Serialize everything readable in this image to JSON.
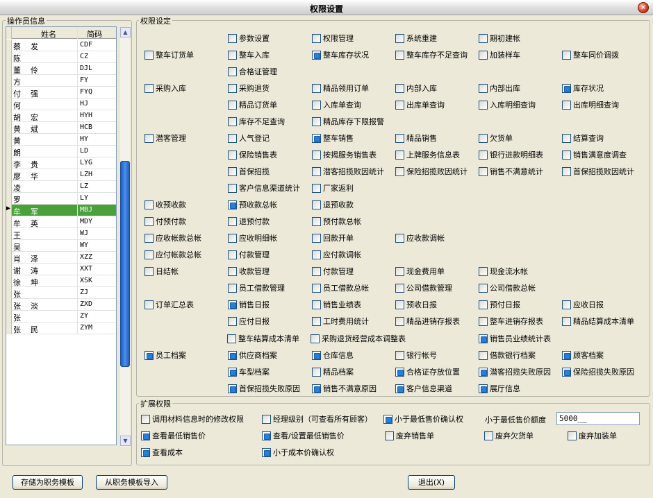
{
  "window": {
    "title": "权限设置",
    "close_glyph": "×"
  },
  "operator_panel": {
    "legend": "操作员信息",
    "columns": [
      "姓名",
      "简码"
    ],
    "rows": [
      {
        "s": "蔡",
        "g": "发",
        "code": "CDF"
      },
      {
        "s": "陈",
        "g": "",
        "code": "CZ"
      },
      {
        "s": "董",
        "g": "伶",
        "code": "DJL"
      },
      {
        "s": "方",
        "g": "",
        "code": "FY"
      },
      {
        "s": "付",
        "g": "强",
        "code": "FYQ"
      },
      {
        "s": "何",
        "g": "",
        "code": "HJ"
      },
      {
        "s": "胡",
        "g": "宏",
        "code": "HYH"
      },
      {
        "s": "黄",
        "g": "斌",
        "code": "HCB"
      },
      {
        "s": "黄",
        "g": "",
        "code": "HY"
      },
      {
        "s": "朗",
        "g": "",
        "code": "LD"
      },
      {
        "s": "李",
        "g": "贵",
        "code": "LYG"
      },
      {
        "s": "廖",
        "g": "华",
        "code": "LZH"
      },
      {
        "s": "凌",
        "g": "",
        "code": "LZ"
      },
      {
        "s": "罗",
        "g": "",
        "code": "LY"
      },
      {
        "s": "牟",
        "g": "军",
        "code": "MBJ"
      },
      {
        "s": "牟",
        "g": "英",
        "code": "MDY"
      },
      {
        "s": "王",
        "g": "",
        "code": "WJ"
      },
      {
        "s": "吴",
        "g": "",
        "code": "WY"
      },
      {
        "s": "肖",
        "g": "泽",
        "code": "XZZ"
      },
      {
        "s": "谢",
        "g": "涛",
        "code": "XXT"
      },
      {
        "s": "徐",
        "g": "坤",
        "code": "XSK"
      },
      {
        "s": "张",
        "g": "",
        "code": "ZJ"
      },
      {
        "s": "张",
        "g": "淡",
        "code": "ZXD"
      },
      {
        "s": "张",
        "g": "",
        "code": "ZY"
      },
      {
        "s": "张",
        "g": "民",
        "code": "ZYM"
      }
    ],
    "selected_code": "MBJ",
    "row_pointer": "▶"
  },
  "permissions_panel": {
    "legend": "权限设定",
    "lines": [
      [
        [
          1,
          "参数设置",
          false
        ],
        [
          2,
          "权限管理",
          false
        ],
        [
          3,
          "系统重建",
          false
        ],
        [
          4,
          "期初建帐",
          false
        ]
      ],
      [
        [
          0,
          "整车订货单",
          false
        ],
        [
          1,
          "整车入库",
          false
        ],
        [
          2,
          "整车库存状况",
          true
        ],
        [
          3,
          "整车库存不足查询",
          false
        ],
        [
          4,
          "加装样车",
          false
        ],
        [
          5,
          "整车同价调拨",
          false
        ]
      ],
      [
        [
          1,
          "合格证管理",
          false
        ]
      ],
      [
        [
          0,
          "采购入库",
          false
        ],
        [
          1,
          "采购退货",
          false
        ],
        [
          2,
          "精品领用订单",
          false
        ],
        [
          3,
          "内部入库",
          false
        ],
        [
          4,
          "内部出库",
          false
        ],
        [
          5,
          "库存状况",
          true
        ]
      ],
      [
        [
          1,
          "精品订货单",
          false
        ],
        [
          2,
          "入库单查询",
          false
        ],
        [
          3,
          "出库单查询",
          false
        ],
        [
          4,
          "入库明细查询",
          false
        ],
        [
          5,
          "出库明细查询",
          false
        ]
      ],
      [
        [
          1,
          "库存不足查询",
          false
        ],
        [
          2,
          "精品库存下限报警",
          false
        ]
      ],
      [
        [
          0,
          "潜客管理",
          false
        ],
        [
          1,
          "人气登记",
          false
        ],
        [
          2,
          "整车销售",
          true
        ],
        [
          3,
          "精品销售",
          false
        ],
        [
          4,
          "欠货单",
          false
        ],
        [
          5,
          "结算查询",
          false
        ]
      ],
      [
        [
          1,
          "保险销售表",
          false
        ],
        [
          2,
          "按揭服务销售表",
          false
        ],
        [
          3,
          "上牌服务信息表",
          false
        ],
        [
          4,
          "银行进款明细表",
          false
        ],
        [
          5,
          "销售满意度调查",
          false
        ]
      ],
      [
        [
          1,
          "首保招揽",
          false
        ],
        [
          2,
          "潜客招揽败因统计",
          false
        ],
        [
          3,
          "保险招揽败因统计",
          false
        ],
        [
          4,
          "销售不满意统计",
          false
        ],
        [
          5,
          "首保招揽败因统计",
          false
        ]
      ],
      [
        [
          1,
          "客户信息渠道统计",
          false
        ],
        [
          2,
          "厂家返利",
          false
        ]
      ],
      [
        [
          0,
          "收预收款",
          false
        ],
        [
          1,
          "预收款总帐",
          true
        ],
        [
          2,
          "退预收款",
          false
        ]
      ],
      [
        [
          0,
          "付预付款",
          false
        ],
        [
          1,
          "退预付款",
          false
        ],
        [
          2,
          "预付款总帐",
          false
        ]
      ],
      [
        [
          0,
          "应收帐款总帐",
          false
        ],
        [
          1,
          "应收明细帐",
          false
        ],
        [
          2,
          "回款开单",
          false
        ],
        [
          3,
          "应收款调帐",
          false
        ]
      ],
      [
        [
          0,
          "应付帐款总帐",
          false
        ],
        [
          1,
          "付款管理",
          false
        ],
        [
          2,
          "应付款调帐",
          false
        ]
      ],
      [
        [
          0,
          "日结帐",
          false
        ],
        [
          1,
          "收款管理",
          false
        ],
        [
          2,
          "付款管理",
          false
        ],
        [
          3,
          "现金费用单",
          false
        ],
        [
          4,
          "现金流水帐",
          false
        ]
      ],
      [
        [
          1,
          "员工借款管理",
          false
        ],
        [
          2,
          "员工借款总帐",
          false
        ],
        [
          3,
          "公司借款管理",
          false
        ],
        [
          4,
          "公司借款总帐",
          false
        ]
      ],
      [
        [
          0,
          "订单汇总表",
          false
        ],
        [
          1,
          "销售日报",
          true
        ],
        [
          2,
          "销售业绩表",
          false
        ],
        [
          3,
          "预收日报",
          false
        ],
        [
          4,
          "预付日报",
          false
        ],
        [
          5,
          "应收日报",
          false
        ]
      ],
      [
        [
          1,
          "应付日报",
          false
        ],
        [
          2,
          "工时费用统计",
          false
        ],
        [
          3,
          "精品进销存报表",
          false
        ],
        [
          4,
          "整车进销存报表",
          false
        ],
        [
          5,
          "精品结算成本清单",
          false
        ]
      ],
      [
        [
          1,
          "整车结算成本清单",
          false
        ],
        [
          2,
          "采购退货经营成本调整表",
          false
        ],
        [
          4,
          "销售员业绩统计表",
          true
        ]
      ],
      [
        [
          0,
          "员工档案",
          true
        ],
        [
          1,
          "供应商档案",
          true
        ],
        [
          2,
          "仓库信息",
          true
        ],
        [
          3,
          "银行帐号",
          false
        ],
        [
          4,
          "借款银行档案",
          false
        ],
        [
          5,
          "顾客档案",
          true
        ]
      ],
      [
        [
          1,
          "车型档案",
          true
        ],
        [
          2,
          "精品档案",
          false
        ],
        [
          3,
          "合格证存放位置",
          true
        ],
        [
          4,
          "潜客招揽失败原因",
          true
        ],
        [
          5,
          "保险招揽失败原因",
          true
        ]
      ],
      [
        [
          1,
          "首保招揽失败原因",
          true
        ],
        [
          2,
          "销售不满意原因",
          true
        ],
        [
          3,
          "客户信息渠道",
          true
        ],
        [
          4,
          "展厅信息",
          true
        ]
      ]
    ]
  },
  "extended_panel": {
    "legend": "扩展权限",
    "items": [
      [
        "调用材料信息时的修改权限",
        false
      ],
      [
        "经理级别（可查看所有顾客）",
        false
      ],
      [
        "小于最低售价确认权",
        true
      ],
      [
        "查看最低销售价",
        true
      ],
      [
        "查看/设置最低销售价",
        true
      ],
      [
        "废弃销售单",
        false
      ],
      [
        "废弃欠货单",
        false
      ],
      [
        "废弃加装单",
        false
      ],
      [
        "查看成本",
        true
      ],
      [
        "小于成本价确认权",
        true
      ]
    ],
    "min_price_label": "小于最低售价额度",
    "min_price_value": "5000__"
  },
  "buttons": {
    "save_template": "存储为职务模板",
    "import_template": "从职务模板导入",
    "exit": "退出(X)"
  }
}
